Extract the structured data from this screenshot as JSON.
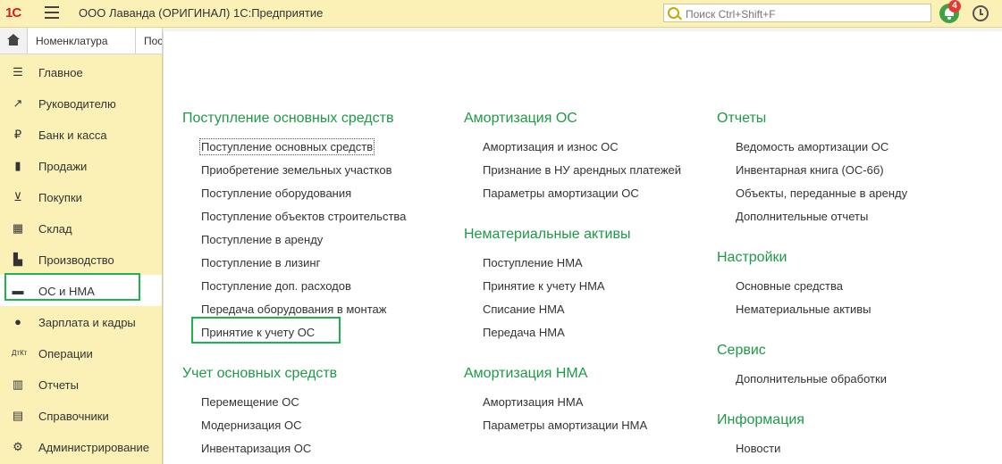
{
  "app": {
    "logo": "1С",
    "title": "ООО Лаванда (ОРИГИНАЛ) 1С:Предприятие",
    "search_placeholder": "Поиск Ctrl+Shift+F",
    "notifications_count": "4"
  },
  "tabs": [
    {
      "label": "Номенклатура",
      "close": "×"
    },
    {
      "label": "Пос"
    }
  ],
  "sidebar": {
    "items": [
      {
        "label": "Главное",
        "icon": "menu-icon"
      },
      {
        "label": "Руководителю",
        "icon": "trend-icon"
      },
      {
        "label": "Банк и касса",
        "icon": "ruble-icon"
      },
      {
        "label": "Продажи",
        "icon": "bag-icon"
      },
      {
        "label": "Покупки",
        "icon": "cart-icon"
      },
      {
        "label": "Склад",
        "icon": "grid-icon"
      },
      {
        "label": "Производство",
        "icon": "factory-icon"
      },
      {
        "label": "ОС и НМА",
        "icon": "truck-icon"
      },
      {
        "label": "Зарплата и кадры",
        "icon": "person-icon"
      },
      {
        "label": "Операции",
        "icon": "dt-kt-icon"
      },
      {
        "label": "Отчеты",
        "icon": "bar-chart-icon"
      },
      {
        "label": "Справочники",
        "icon": "books-icon"
      },
      {
        "label": "Администрирование",
        "icon": "gear-icon"
      }
    ],
    "active": "ОС и НМА"
  },
  "panel": {
    "col1": {
      "section1": {
        "title": "Поступление основных средств",
        "links": [
          "Поступление основных средств",
          "Приобретение земельных участков",
          "Поступление оборудования",
          "Поступление объектов строительства",
          "Поступление в аренду",
          "Поступление в лизинг",
          "Поступление доп. расходов",
          "Передача оборудования в монтаж",
          "Принятие к учету ОС"
        ]
      },
      "section2": {
        "title": "Учет основных средств",
        "links": [
          "Перемещение ОС",
          "Модернизация ОС",
          "Инвентаризация ОС"
        ]
      }
    },
    "col2": {
      "section1": {
        "title": "Амортизация ОС",
        "links": [
          "Амортизация и износ ОС",
          "Признание в НУ арендных платежей",
          "Параметры амортизации ОС"
        ]
      },
      "section2": {
        "title": "Нематериальные активы",
        "links": [
          "Поступление НМА",
          "Принятие к учету НМА",
          "Списание НМА",
          "Передача НМА"
        ]
      },
      "section3": {
        "title": "Амортизация НМА",
        "links": [
          "Амортизация НМА",
          "Параметры амортизации НМА"
        ]
      }
    },
    "col3": {
      "section1": {
        "title": "Отчеты",
        "links": [
          "Ведомость амортизации ОС",
          "Инвентарная книга (ОС-6б)",
          "Объекты, переданные в аренду",
          "Дополнительные отчеты"
        ]
      },
      "section2": {
        "title": "Настройки",
        "links": [
          "Основные средства",
          "Нематериальные активы"
        ]
      },
      "section3": {
        "title": "Сервис",
        "links": [
          "Дополнительные обработки"
        ]
      },
      "section4": {
        "title": "Информация",
        "links": [
          "Новости"
        ]
      }
    }
  }
}
